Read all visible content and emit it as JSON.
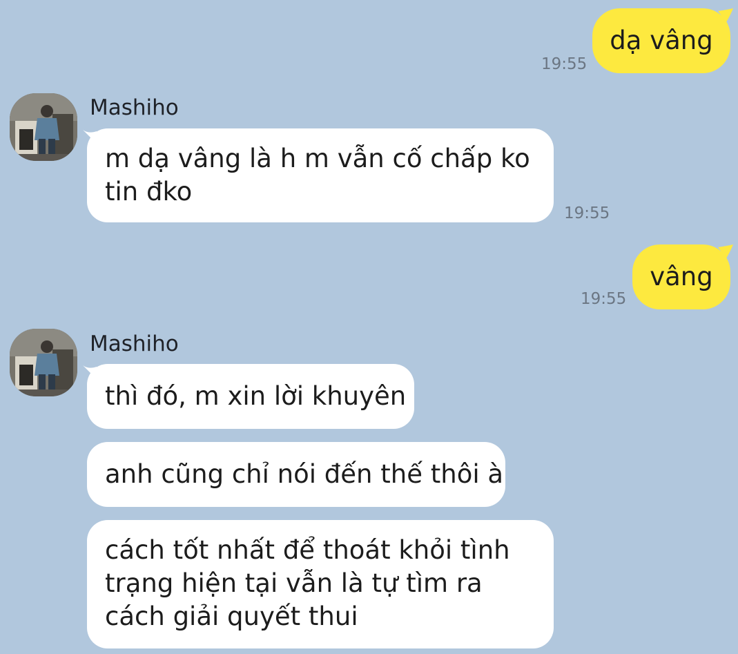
{
  "conversation": {
    "messages": [
      {
        "id": "m1",
        "direction": "outgoing",
        "text": "dạ vâng",
        "time": "19:55"
      },
      {
        "id": "m2",
        "direction": "incoming",
        "sender": "Mashiho",
        "lines": [
          "m dạ vâng là h m vẫn cố chấp ko",
          "tin đko"
        ],
        "time": "19:55"
      },
      {
        "id": "m3",
        "direction": "outgoing",
        "text": "vâng",
        "time": "19:55"
      },
      {
        "id": "m4",
        "direction": "incoming",
        "sender": "Mashiho",
        "text": "thì đó, m xin lời khuyên"
      },
      {
        "id": "m5",
        "direction": "incoming",
        "text": "anh cũng chỉ nói đến thế thôi à"
      },
      {
        "id": "m6",
        "direction": "incoming",
        "lines": [
          "cách tốt nhất để thoát khỏi tình",
          "trạng hiện tại vẫn là tự tìm ra",
          "cách giải quyết thui"
        ]
      }
    ]
  },
  "colors": {
    "background": "#b1c7dd",
    "incoming_bubble": "#ffffff",
    "outgoing_bubble": "#fde93f",
    "timestamp": "#6b7683"
  },
  "icons": {
    "avatar": "profile-photo"
  }
}
